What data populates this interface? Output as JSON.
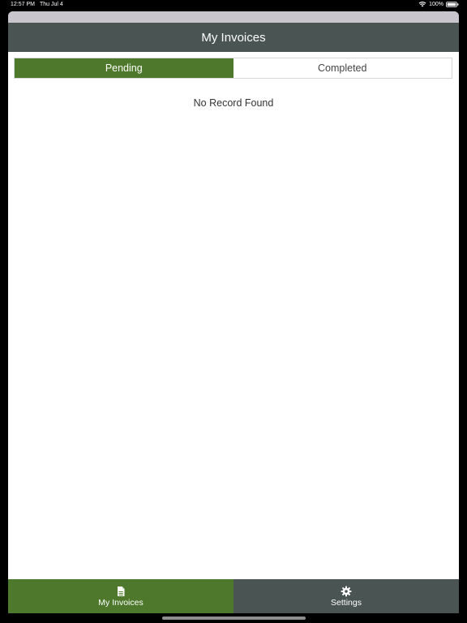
{
  "status_bar": {
    "time": "12:57 PM",
    "date": "Thu Jul 4",
    "battery": "100%",
    "wifi_icon": "wifi-icon",
    "battery_icon": "battery-icon"
  },
  "header": {
    "title": "My Invoices"
  },
  "segments": [
    {
      "label": "Pending",
      "active": true
    },
    {
      "label": "Completed",
      "active": false
    }
  ],
  "main": {
    "empty_message": "No Record Found"
  },
  "tab_bar": {
    "items": [
      {
        "label": "My Invoices",
        "icon": "document-icon",
        "active": true
      },
      {
        "label": "Settings",
        "icon": "gear-icon",
        "active": false
      }
    ]
  },
  "colors": {
    "accent_green": "#4e792c",
    "header_gray": "#4a5452"
  }
}
